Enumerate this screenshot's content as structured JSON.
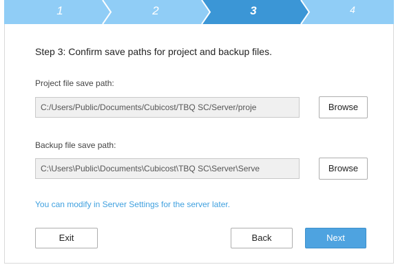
{
  "stepper": {
    "steps": [
      "1",
      "2",
      "3",
      "4"
    ],
    "active_index": 2,
    "colors": {
      "inactive": "#90cdf6",
      "active": "#3b96d6"
    }
  },
  "title": "Step 3: Confirm save paths for project and backup files.",
  "project": {
    "label": "Project file save path:",
    "value": "C:/Users/Public/Documents/Cubicost/TBQ SC/Server/proje",
    "browse_label": "Browse"
  },
  "backup": {
    "label": "Backup file save path:",
    "value": "C:\\Users\\Public\\Documents\\Cubicost\\TBQ SC\\Server\\Serve",
    "browse_label": "Browse"
  },
  "note": "You can modify in Server Settings for the server later.",
  "buttons": {
    "exit": "Exit",
    "back": "Back",
    "next": "Next"
  }
}
